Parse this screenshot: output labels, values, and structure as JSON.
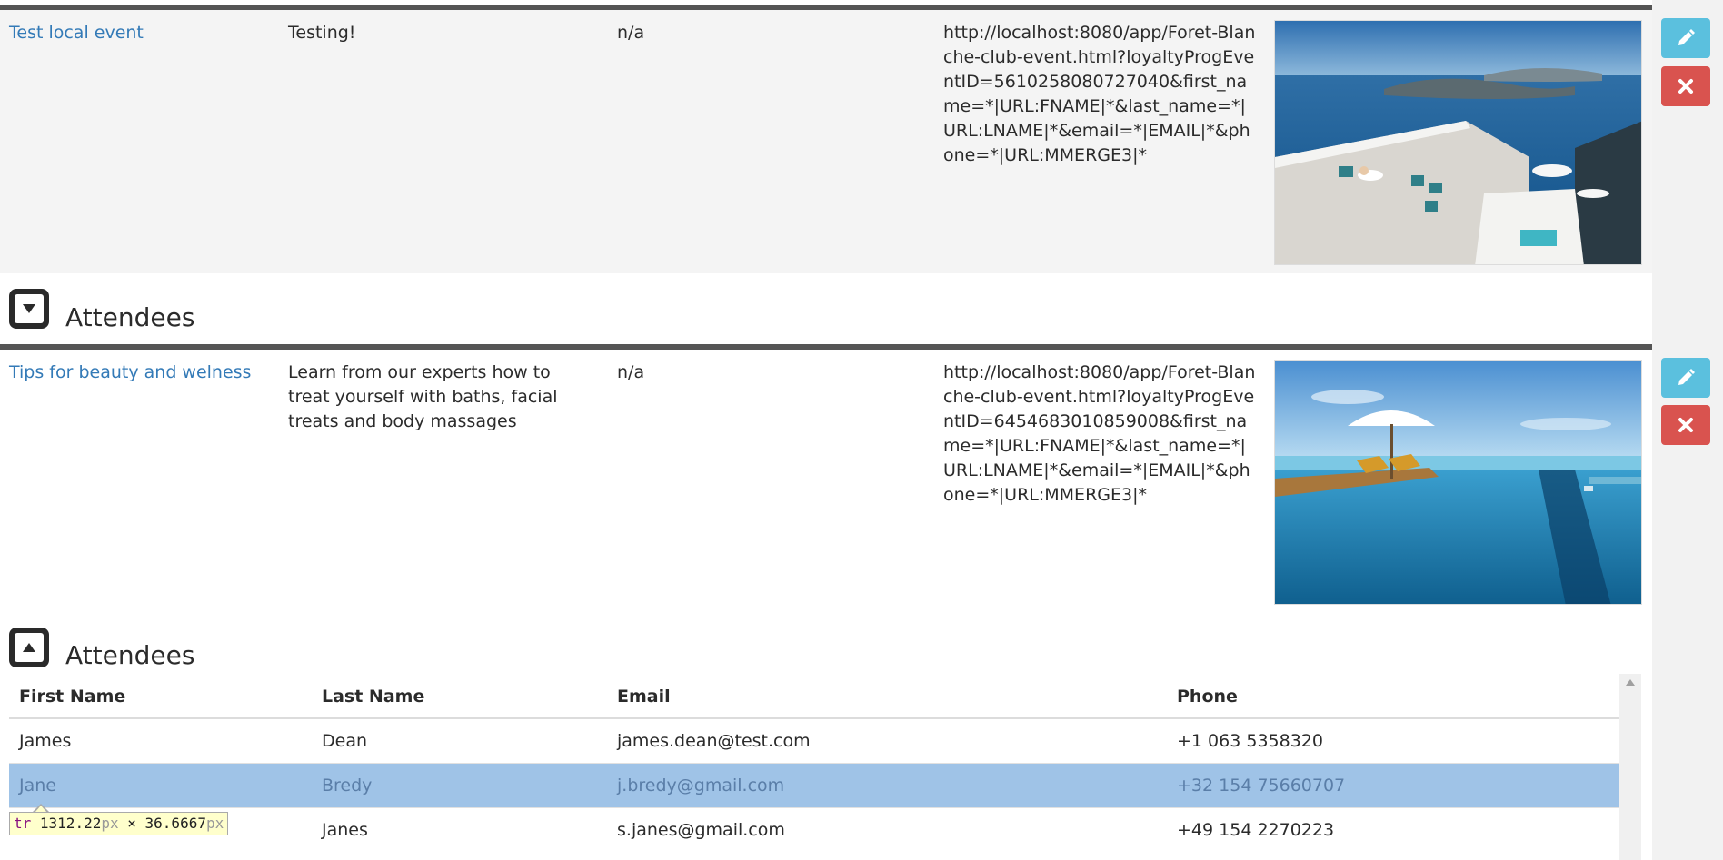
{
  "colors": {
    "link": "#337ab7",
    "edit_button": "#5bc0de",
    "delete_button": "#d9534f",
    "selected_row": "#9fc3e7"
  },
  "events": [
    {
      "title": "Test local event",
      "description": "Testing!",
      "location": "n/a",
      "url": "http://localhost:8080/app/Foret-Blanche-club-event.html?loyaltyProgEventID=5610258080727040&first_name=*|URL:FNAME|*&last_name=*|URL:LNAME|*&email=*|EMAIL|*&phone=*|URL:MMERGE3|*",
      "image": "terrace-sea-view-photo",
      "edit_icon": "pencil-icon",
      "delete_icon": "close-icon",
      "attendees_title": "Attendees",
      "attendees_toggle_icon": "caret-down-square-icon"
    },
    {
      "title": "Tips for beauty and welness",
      "description": "Learn from our experts how to treat yourself with baths, facial treats and body massages",
      "location": "n/a",
      "url": "http://localhost:8080/app/Foret-Blanche-club-event.html?loyaltyProgEventID=6454683010859008&first_name=*|URL:FNAME|*&last_name=*|URL:LNAME|*&email=*|EMAIL|*&phone=*|URL:MMERGE3|*",
      "image": "infinity-pool-photo",
      "edit_icon": "pencil-icon",
      "delete_icon": "close-icon",
      "attendees_title": "Attendees",
      "attendees_toggle_icon": "caret-up-square-icon"
    }
  ],
  "attendees_table": {
    "columns": [
      "First Name",
      "Last Name",
      "Email",
      "Phone"
    ],
    "rows": [
      {
        "first": "James",
        "last": "Dean",
        "email": "james.dean@test.com",
        "phone": "+1 063 5358320",
        "selected": false
      },
      {
        "first": "Jane",
        "last": "Bredy",
        "email": "j.bredy@gmail.com",
        "phone": "+32 154 75660707",
        "selected": true
      },
      {
        "first": "",
        "last": "Janes",
        "email": "s.janes@gmail.com",
        "phone": "+49 154 2270223",
        "selected": false
      }
    ]
  },
  "tooltip": {
    "tag": "tr",
    "width_value": "1312.22",
    "height_value": "36.6667",
    "unit": "px",
    "separator": "×"
  }
}
